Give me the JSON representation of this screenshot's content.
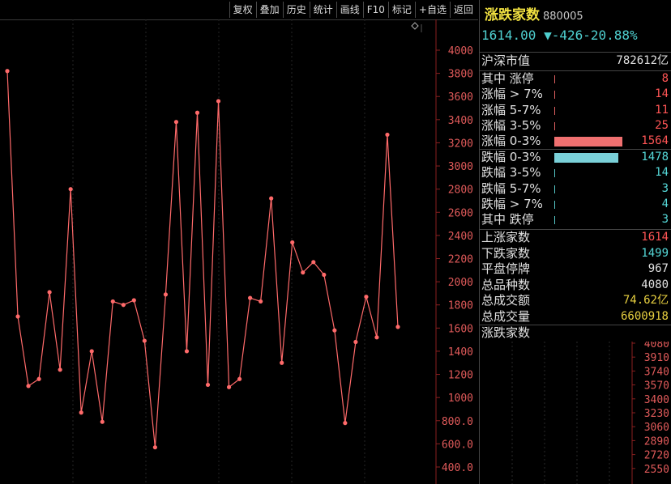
{
  "toolbar": {
    "buttons": [
      "复权",
      "叠加",
      "历史",
      "统计",
      "画线",
      "F10",
      "标记",
      "+自选",
      "返回"
    ]
  },
  "chart_data": {
    "type": "line",
    "ylim": [
      400,
      4000
    ],
    "yticks": [
      "4000",
      "3800",
      "3600",
      "3400",
      "3200",
      "3000",
      "2800",
      "2600",
      "2400",
      "2200",
      "2000",
      "1800",
      "1600",
      "1400",
      "1200",
      "1000",
      "800.0",
      "600.0",
      "400.0"
    ],
    "values": [
      3820,
      1700,
      1100,
      1160,
      1910,
      1240,
      2800,
      870,
      1400,
      790,
      1830,
      1800,
      1840,
      1490,
      570,
      1890,
      3380,
      1400,
      3460,
      1110,
      3560,
      1090,
      1160,
      1860,
      1830,
      2720,
      1300,
      2340,
      2080,
      2170,
      2060,
      1580,
      780,
      1480,
      1870,
      1520,
      3270,
      1610
    ],
    "line_color": "#ff6a6a"
  },
  "panel": {
    "title": "涨跌家数",
    "code": "880005",
    "price": "1614.00",
    "arrow": "▼",
    "change": "-426",
    "pct": "-20.88%",
    "market_value_label": "沪深市值",
    "market_value": "782612亿",
    "up_rows": [
      {
        "label": "其中 涨停",
        "value": "8"
      },
      {
        "label": "涨幅 > 7%",
        "value": "14"
      },
      {
        "label": "涨幅 5-7%",
        "value": "11"
      },
      {
        "label": "涨幅 3-5%",
        "value": "25"
      },
      {
        "label": "涨幅 0-3%",
        "value": "1564"
      }
    ],
    "down_rows": [
      {
        "label": "跌幅 0-3%",
        "value": "1478"
      },
      {
        "label": "跌幅 3-5%",
        "value": "14"
      },
      {
        "label": "跌幅 5-7%",
        "value": "3"
      },
      {
        "label": "跌幅 > 7%",
        "value": "4"
      },
      {
        "label": "其中 跌停",
        "value": "3"
      }
    ],
    "up_bar_fraction": 0.91,
    "down_bar_fraction": 0.86,
    "stats": [
      {
        "label": "上涨家数",
        "value": "1614",
        "color": "red"
      },
      {
        "label": "下跌家数",
        "value": "1499",
        "color": "cyan"
      },
      {
        "label": "平盘停牌",
        "value": "967",
        "color": "white"
      },
      {
        "label": "总品种数",
        "value": "4080",
        "color": "white"
      },
      {
        "label": "总成交额",
        "value": "74.62亿",
        "color": "yellow"
      },
      {
        "label": "总成交量",
        "value": "6600918",
        "color": "yellow"
      }
    ],
    "mini_title": "涨跌家数",
    "mini_yticks": [
      "4080",
      "3910",
      "3740",
      "3570",
      "3400",
      "3230",
      "3060",
      "2890",
      "2720",
      "2550"
    ]
  }
}
